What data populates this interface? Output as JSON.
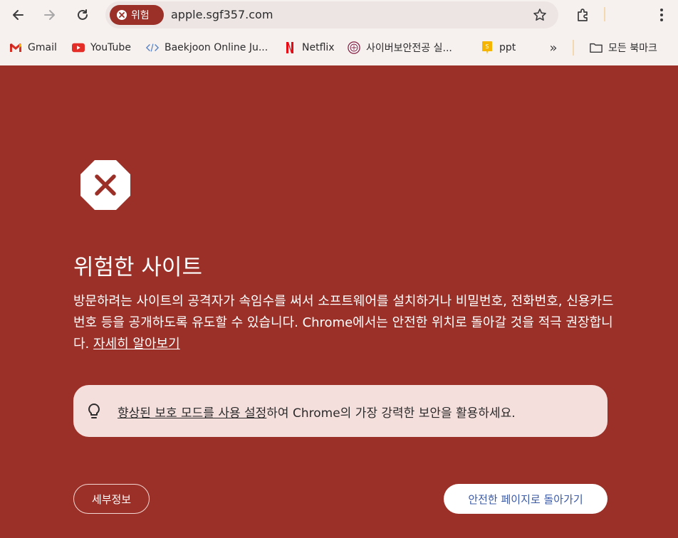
{
  "browser": {
    "security_chip_label": "위험",
    "url": "apple.sgf357.com",
    "icons": {
      "back": "back-arrow-icon",
      "forward": "forward-arrow-icon",
      "reload": "reload-icon",
      "bookmark_star": "star-icon",
      "extensions": "puzzle-icon",
      "menu": "kebab-menu-icon"
    }
  },
  "bookmarks": {
    "items": [
      {
        "label": "Gmail",
        "icon": "gmail-icon"
      },
      {
        "label": "YouTube",
        "icon": "youtube-icon"
      },
      {
        "label": "Baekjoon Online Ju...",
        "icon": "code-icon"
      },
      {
        "label": "Netflix",
        "icon": "netflix-icon"
      },
      {
        "label": "사이버보안전공 실...",
        "icon": "university-seal-icon"
      },
      {
        "label": "ppt",
        "icon": "slides-icon"
      }
    ],
    "more_label": "»",
    "all_bookmarks_label": "모든 북마크"
  },
  "interstitial": {
    "headline": "위험한 사이트",
    "message": "방문하려는 사이트의 공격자가 속임수를 써서 소프트웨어를 설치하거나 비밀번호, 전화번호, 신용카드 번호 등을 공개하도록 유도할 수 있습니다. Chrome에서는 안전한 위치로 돌아갈 것을 적극 권장합니다.",
    "learn_more_link": "자세히 알아보기",
    "enhanced_protection_link": "향상된 보호 모드를 사용 설정",
    "enhanced_protection_suffix": "하여 Chrome의 가장 강력한 보안을 활용하세요.",
    "details_button": "세부정보",
    "back_to_safety_button": "안전한 페이지로 돌아가기"
  },
  "colors": {
    "danger_background": "#9b3028",
    "enhanced_box": "#f5dfdd",
    "back_button_text": "#3a59a6",
    "chrome_toolbar": "#f6f0ef"
  }
}
